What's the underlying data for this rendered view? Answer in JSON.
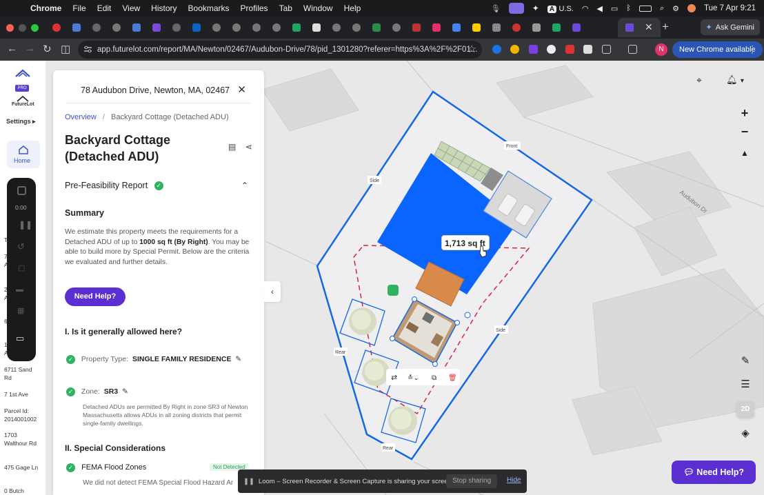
{
  "menubar": {
    "app": "Chrome",
    "items": [
      "File",
      "Edit",
      "View",
      "History",
      "Bookmarks",
      "Profiles",
      "Tab",
      "Window",
      "Help"
    ],
    "input_source": "U.S.",
    "datetime": "Tue 7 Apr  9:21"
  },
  "tabs": {
    "ask_gemini": "Ask Gemini"
  },
  "toolbar": {
    "url": "app.futurelot.com/report/MA/Newton/02467/Audubon-Drive/78/pid_1301280?referer=https%3A%2F%2F01...",
    "profile_initial": "N",
    "new_chrome": "New Chrome available"
  },
  "rail": {
    "brand": "FutureLot",
    "pro": "PRO",
    "settings": "Settings",
    "home": "Home",
    "timer": "0:00"
  },
  "leftlist": {
    "l1": "6711 Sand",
    "l1b": "Rd",
    "l2": "7 1st Ave",
    "l3": "Parcel Id:",
    "l3b": "2014001002",
    "l4": "1703",
    "l4b": "Walthour Rd",
    "l5": "475 Gage Ln",
    "l6": "0 Butch",
    "t1": "T",
    "t2": "7",
    "t2b": "A",
    "t3": "2",
    "t3b": "A",
    "t4": "6",
    "t5": "1",
    "t5b": "A"
  },
  "panel": {
    "address": "78 Audubon Drive, Newton, MA, 02467",
    "breadcrumb_root": "Overview",
    "breadcrumb_sep": "/",
    "breadcrumb_current": "Backyard Cottage (Detached ADU)",
    "title_line1": "Backyard Cottage",
    "title_line2": "(Detached ADU)",
    "prefeasibility": "Pre-Feasibility Report",
    "summary_heading": "Summary",
    "summary_pre": "We estimate this property meets the requirements for a Detached ADU of up to ",
    "summary_bold": "1000 sq ft (By Right)",
    "summary_post": ". You may be able to build more by Special Permit. Below are the criteria we evaluated and further details.",
    "need_help": "Need Help?",
    "section1": "I. Is it generally allowed here?",
    "property_type_label": "Property Type:",
    "property_type_value": "SINGLE FAMILY RESIDENCE",
    "zone_label": "Zone:",
    "zone_value": "SR3",
    "zone_note": "Detached ADUs are permitted By Right in zone SR3 of Newton Massachusetts allows ADUs in all zoning districts that permit single-family dwellings.",
    "section2": "II. Special Considerations",
    "fema_label": "FEMA Flood Zones",
    "fema_status": "Not Detected",
    "fema_note": "We did not detect FEMA Special Flood Hazard Ar"
  },
  "map": {
    "area_label": "1,713 sq ft",
    "street": "Audubon Dr",
    "front": "Front",
    "side_left": "Side",
    "side_right": "Side",
    "rear_left": "Rear",
    "rear_bottom": "Rear",
    "need_help": "Need Help?"
  },
  "loom": {
    "message": "Loom – Screen Recorder & Screen Capture is sharing your screen.",
    "stop": "Stop sharing",
    "hide": "Hide"
  },
  "colors": {
    "accent": "#5b2fd1",
    "building": "#0a64ff",
    "lot_outline": "#1466e8",
    "setback": "#d9233a",
    "check_green": "#2fb35e"
  }
}
